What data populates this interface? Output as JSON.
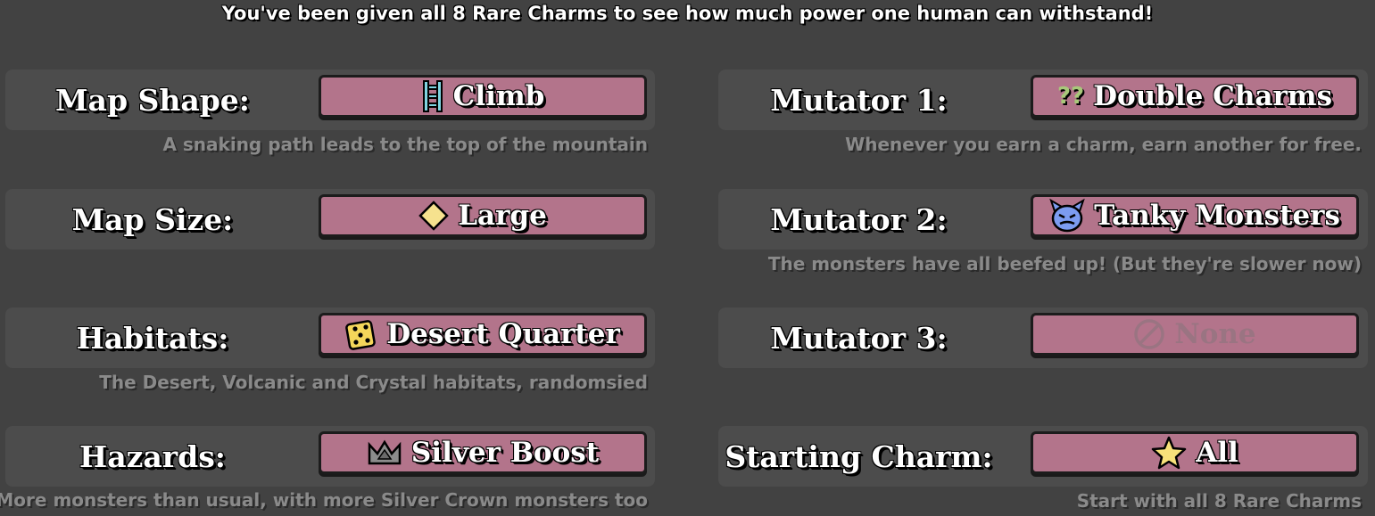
{
  "header": "You've been given all 8 Rare Charms to see how much power one human can withstand!",
  "left": [
    {
      "label": "Map Shape:",
      "value": "Climb",
      "icon": "ladder-icon",
      "desc": "A snaking path leads to the top of the mountain"
    },
    {
      "label": "Map Size:",
      "value": "Large",
      "icon": "diamond-icon",
      "desc": ""
    },
    {
      "label": "Habitats:",
      "value": "Desert Quarter",
      "icon": "dice-icon",
      "desc": "The Desert, Volcanic and Crystal habitats, randomsied"
    },
    {
      "label": "Hazards:",
      "value": "Silver Boost",
      "icon": "crown-icon",
      "desc": "More monsters than usual, with more Silver Crown monsters too"
    }
  ],
  "right": [
    {
      "label": "Mutator 1:",
      "value": "Double Charms",
      "icon": "question-marks-icon",
      "icon_text": "??",
      "desc": "Whenever you earn a charm, earn another for free."
    },
    {
      "label": "Mutator 2:",
      "value": "Tanky Monsters",
      "icon": "monster-face-icon",
      "desc": "The monsters have all beefed up! (But they're slower now)"
    },
    {
      "label": "Mutator 3:",
      "value": "None",
      "icon": "none-icon",
      "desc": ""
    },
    {
      "label": "Starting Charm:",
      "value": "All",
      "icon": "star-icon",
      "desc": "Start with all 8 Rare Charms"
    }
  ],
  "colors": {
    "background": "#424242",
    "row": "#4c4c4c",
    "button": "#b3748b",
    "desc_text": "#8a8a8a"
  }
}
